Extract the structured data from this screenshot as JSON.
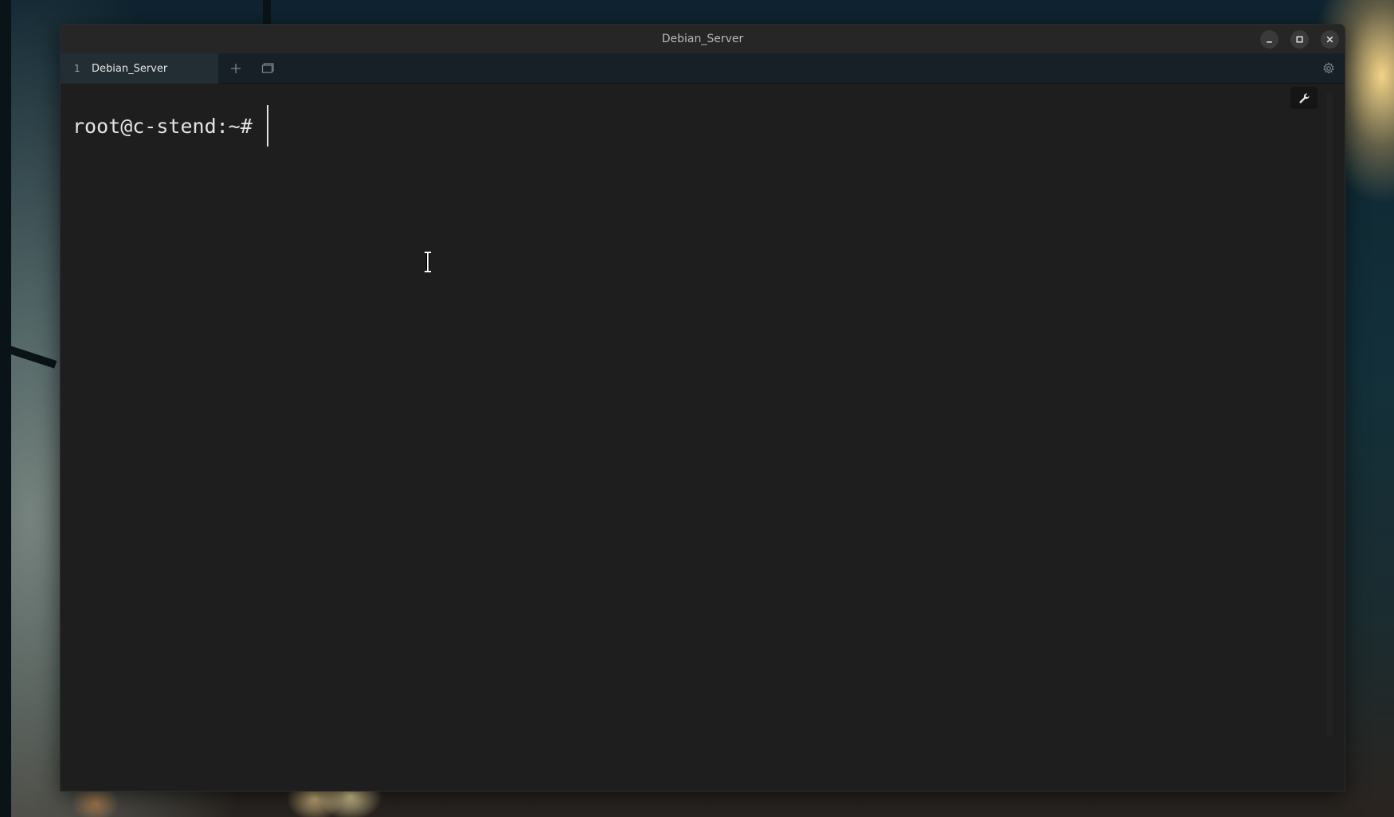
{
  "window": {
    "title": "Debian_Server",
    "controls": {
      "minimize_icon": "minimize-icon",
      "maximize_icon": "maximize-icon",
      "close_icon": "close-icon"
    }
  },
  "tabs": [
    {
      "number": "1",
      "label": "Debian_Server",
      "active": true
    }
  ],
  "toolbar": {
    "new_tab_icon": "plus-icon",
    "tab_overview_icon": "tab-overview-icon",
    "settings_icon": "gear-icon"
  },
  "terminal": {
    "prompt": "root@c-stend:~# ",
    "input": "",
    "profile_icon": "wrench-icon"
  },
  "colors": {
    "terminal_bg": "#1e1e1e",
    "titlebar_bg": "#262626",
    "tabbar_bg": "#172026",
    "active_tab_bg": "#232d34",
    "text": "#e4e4e4"
  }
}
